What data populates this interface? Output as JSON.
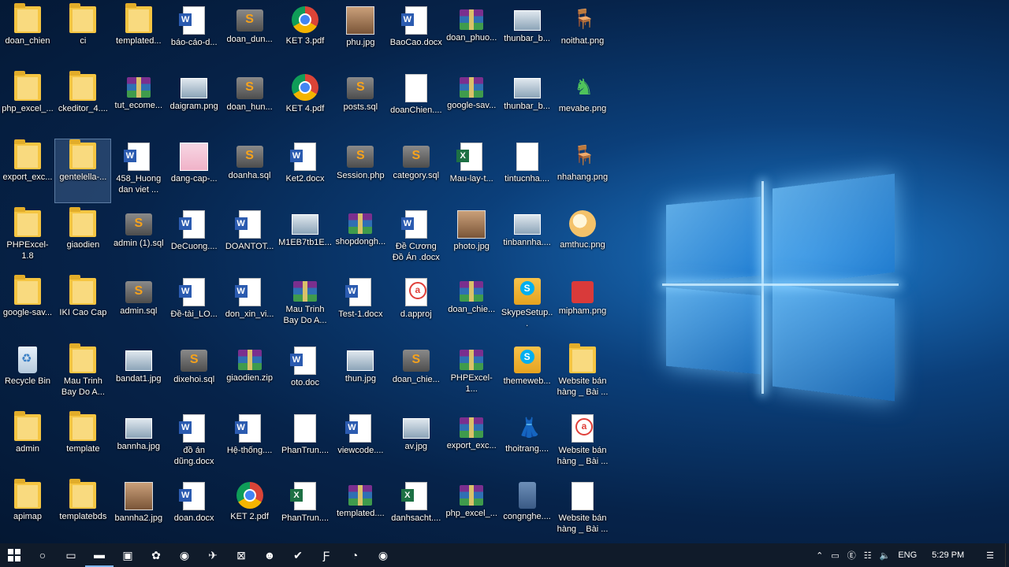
{
  "desktop": {
    "icons": [
      {
        "label": "doan_chien",
        "type": "folder"
      },
      {
        "label": "ci",
        "type": "folder"
      },
      {
        "label": "templated...",
        "type": "folder"
      },
      {
        "label": "báo-cáo-d...",
        "type": "word"
      },
      {
        "label": "doan_dun...",
        "type": "sql"
      },
      {
        "label": "KET 3.pdf",
        "type": "chrome"
      },
      {
        "label": "phu.jpg",
        "type": "photo"
      },
      {
        "label": "BaoCao.docx",
        "type": "word"
      },
      {
        "label": "doan_phuo...",
        "type": "rar"
      },
      {
        "label": "thunbar_b...",
        "type": "img"
      },
      {
        "label": "noithat.png",
        "type": "table"
      },
      {
        "label": "php_excel_...",
        "type": "folder"
      },
      {
        "label": "ckeditor_4....",
        "type": "folder"
      },
      {
        "label": "tut_ecome...",
        "type": "rar"
      },
      {
        "label": "daigram.png",
        "type": "img"
      },
      {
        "label": "doan_hun...",
        "type": "sql"
      },
      {
        "label": "KET 4.pdf",
        "type": "chrome"
      },
      {
        "label": "posts.sql",
        "type": "sql"
      },
      {
        "label": "doanChien....",
        "type": "doc"
      },
      {
        "label": "google-sav...",
        "type": "rar"
      },
      {
        "label": "thunbar_b...",
        "type": "img"
      },
      {
        "label": "mevabe.png",
        "type": "green"
      },
      {
        "label": "export_exc...",
        "type": "folder"
      },
      {
        "label": "gentelella-...",
        "type": "folder",
        "selected": true
      },
      {
        "label": "458_Huong dan viet ...",
        "type": "word"
      },
      {
        "label": "dang-cap-...",
        "type": "pink"
      },
      {
        "label": "doanha.sql",
        "type": "sql"
      },
      {
        "label": "Ket2.docx",
        "type": "word"
      },
      {
        "label": "Session.php",
        "type": "sql"
      },
      {
        "label": "category.sql",
        "type": "sql"
      },
      {
        "label": "Mau-lay-t...",
        "type": "excel"
      },
      {
        "label": "tintucnha....",
        "type": "doc"
      },
      {
        "label": "nhahang.png",
        "type": "table"
      },
      {
        "label": "PHPExcel-1.8",
        "type": "folder"
      },
      {
        "label": "giaodien",
        "type": "folder"
      },
      {
        "label": "admin (1).sql",
        "type": "sql"
      },
      {
        "label": "DeCuong....",
        "type": "word"
      },
      {
        "label": "DOANTOT...",
        "type": "word"
      },
      {
        "label": "M1EB7tb1E...",
        "type": "img"
      },
      {
        "label": "shopdongh...",
        "type": "rar"
      },
      {
        "label": "Đề Cương Đồ Án .docx",
        "type": "word"
      },
      {
        "label": "photo.jpg",
        "type": "photo"
      },
      {
        "label": "tinbannha....",
        "type": "img"
      },
      {
        "label": "amthuc.png",
        "type": "color"
      },
      {
        "label": "google-sav...",
        "type": "folder"
      },
      {
        "label": "IKI Cao Cap",
        "type": "folder"
      },
      {
        "label": "admin.sql",
        "type": "sql"
      },
      {
        "label": "Đề-tài_LO...",
        "type": "word"
      },
      {
        "label": "don_xin_vi...",
        "type": "word"
      },
      {
        "label": "Mau Trinh Bay Do A...",
        "type": "rar"
      },
      {
        "label": "Test-1.docx",
        "type": "word"
      },
      {
        "label": "d.approj",
        "type": "red"
      },
      {
        "label": "doan_chie...",
        "type": "rar"
      },
      {
        "label": "SkypeSetup...",
        "type": "skype"
      },
      {
        "label": "mipham.png",
        "type": "red2"
      },
      {
        "label": "Recycle Bin",
        "type": "recycle"
      },
      {
        "label": "Mau Trinh Bay Do A...",
        "type": "folder"
      },
      {
        "label": "bandat1.jpg",
        "type": "img"
      },
      {
        "label": "dixehoi.sql",
        "type": "sql"
      },
      {
        "label": "giaodien.zip",
        "type": "rar"
      },
      {
        "label": "oto.doc",
        "type": "word"
      },
      {
        "label": "thun.jpg",
        "type": "img"
      },
      {
        "label": "doan_chie...",
        "type": "sql"
      },
      {
        "label": "PHPExcel-1...",
        "type": "rar"
      },
      {
        "label": "themeweb...",
        "type": "skype"
      },
      {
        "label": "Website bán hàng _ Bài ...",
        "type": "folder"
      },
      {
        "label": "admin",
        "type": "folder"
      },
      {
        "label": "template",
        "type": "folder"
      },
      {
        "label": "bannha.jpg",
        "type": "img"
      },
      {
        "label": "đồ án dũng.docx",
        "type": "word"
      },
      {
        "label": "Hệ-thống....",
        "type": "word"
      },
      {
        "label": "PhanTrun....",
        "type": "doc"
      },
      {
        "label": "viewcode....",
        "type": "word"
      },
      {
        "label": "av.jpg",
        "type": "img"
      },
      {
        "label": "export_exc...",
        "type": "rar"
      },
      {
        "label": "thoitrang....",
        "type": "dress"
      },
      {
        "label": "Website bán hàng _ Bài ...",
        "type": "red"
      },
      {
        "label": "apimap",
        "type": "folder"
      },
      {
        "label": "templatebds",
        "type": "folder"
      },
      {
        "label": "bannha2.jpg",
        "type": "photo"
      },
      {
        "label": "doan.docx",
        "type": "word"
      },
      {
        "label": "KET 2.pdf",
        "type": "chrome"
      },
      {
        "label": "PhanTrun....",
        "type": "excel"
      },
      {
        "label": "templated....",
        "type": "rar"
      },
      {
        "label": "danhsacht....",
        "type": "excel"
      },
      {
        "label": "php_excel_...",
        "type": "rar"
      },
      {
        "label": "congnghe....",
        "type": "phone"
      },
      {
        "label": "Website bán hàng _ Bài ...",
        "type": "doc"
      }
    ]
  },
  "taskbar": {
    "start_icon": "windows-icon",
    "apps": [
      {
        "name": "cortana-icon",
        "glyph": "○"
      },
      {
        "name": "task-view-icon",
        "glyph": "▭"
      },
      {
        "name": "file-explorer-icon",
        "glyph": "▬",
        "active": true
      },
      {
        "name": "sublime-icon",
        "glyph": "▣"
      },
      {
        "name": "paint-icon",
        "glyph": "✿"
      },
      {
        "name": "chrome-icon",
        "glyph": "◉"
      },
      {
        "name": "tool-icon",
        "glyph": "✈"
      },
      {
        "name": "xampp-icon",
        "glyph": "⊠"
      },
      {
        "name": "user-icon",
        "glyph": "☻"
      },
      {
        "name": "app-icon",
        "glyph": "✔"
      },
      {
        "name": "filezilla-icon",
        "glyph": "Ƒ"
      },
      {
        "name": "messaging-icon",
        "glyph": "◔"
      },
      {
        "name": "chrome2-icon",
        "glyph": "◉"
      }
    ],
    "tray": {
      "language": "ENG",
      "time": "5:29 PM"
    }
  },
  "colors": {
    "taskbar": "#101b2a",
    "desktop_accent": "#1e78c8"
  }
}
